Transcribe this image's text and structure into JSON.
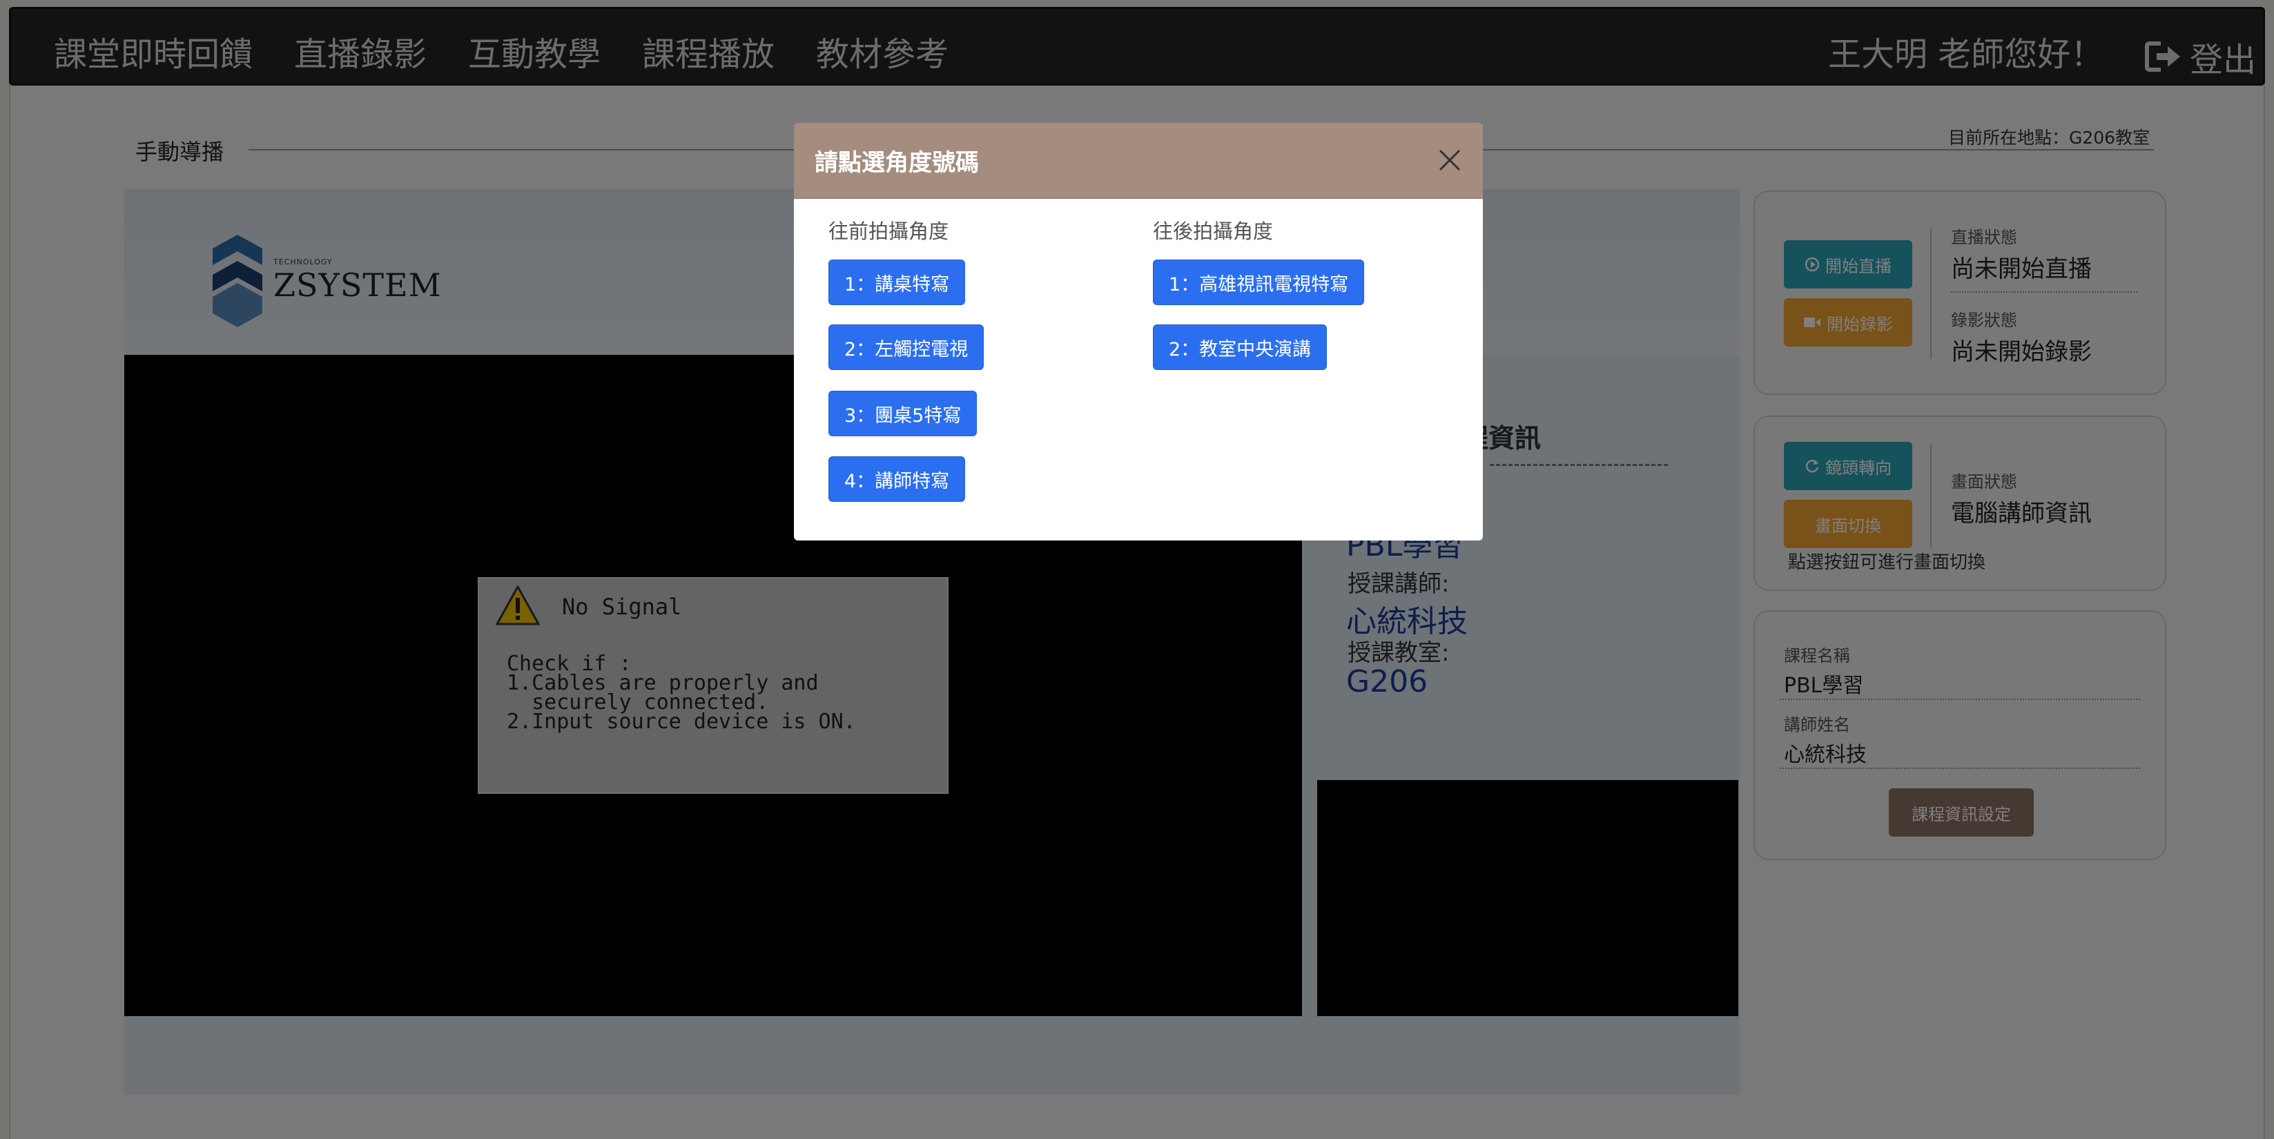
{
  "nav": {
    "items": [
      "課堂即時回饋",
      "直播錄影",
      "互動教學",
      "課程播放",
      "教材參考"
    ],
    "greeting": "王大明 老師您好！",
    "logout_label": "登出"
  },
  "section": {
    "title": "手動導播",
    "location": "目前所在地點：G206教室"
  },
  "logo": {
    "small": "TECHNOLOGY",
    "big": "ZSYSTEM"
  },
  "no_signal": {
    "title": "No Signal",
    "body": "Check if :\n1.Cables are properly and\n  securely connected.\n2.Input source device is ON."
  },
  "course_panel": {
    "heading": "程資訊",
    "course_name_partial": "PBL學習",
    "teacher_label": "授課講師:",
    "teacher_value": "心統科技",
    "room_label": "授課教室:",
    "room_value": "G206"
  },
  "stream_card": {
    "start_stream": "開始直播",
    "start_record": "開始錄影",
    "stream_status_label": "直播狀態",
    "stream_status_value": "尚未開始直播",
    "record_status_label": "錄影狀態",
    "record_status_value": "尚未開始錄影"
  },
  "screen_card": {
    "lens_turn": "鏡頭轉向",
    "screen_switch": "畫面切換",
    "screen_status_label": "畫面狀態",
    "screen_status_value": "電腦講師資訊",
    "hint": "點選按鈕可進行畫面切換"
  },
  "course_card": {
    "name_label": "課程名稱",
    "name_value": "PBL學習",
    "teacher_label": "講師姓名",
    "teacher_value": "心統科技",
    "settings_button": "課程資訊設定"
  },
  "modal": {
    "title": "請點選角度號碼",
    "front_heading": "往前拍攝角度",
    "back_heading": "往後拍攝角度",
    "front_buttons": [
      "1：講桌特寫",
      "2：左觸控電視",
      "3：團桌5特寫",
      "4：講師特寫"
    ],
    "back_buttons": [
      "1：高雄視訊電視特寫",
      "2：教室中央演講"
    ]
  },
  "colors": {
    "nav_bg": "#252525",
    "teal": "#2ca4b8",
    "orange": "#f0a431",
    "brown": "#8d7363",
    "modal_header": "#a48d7f",
    "primary_blue": "#2b6ff0",
    "course_blue": "#1c3b9a"
  }
}
